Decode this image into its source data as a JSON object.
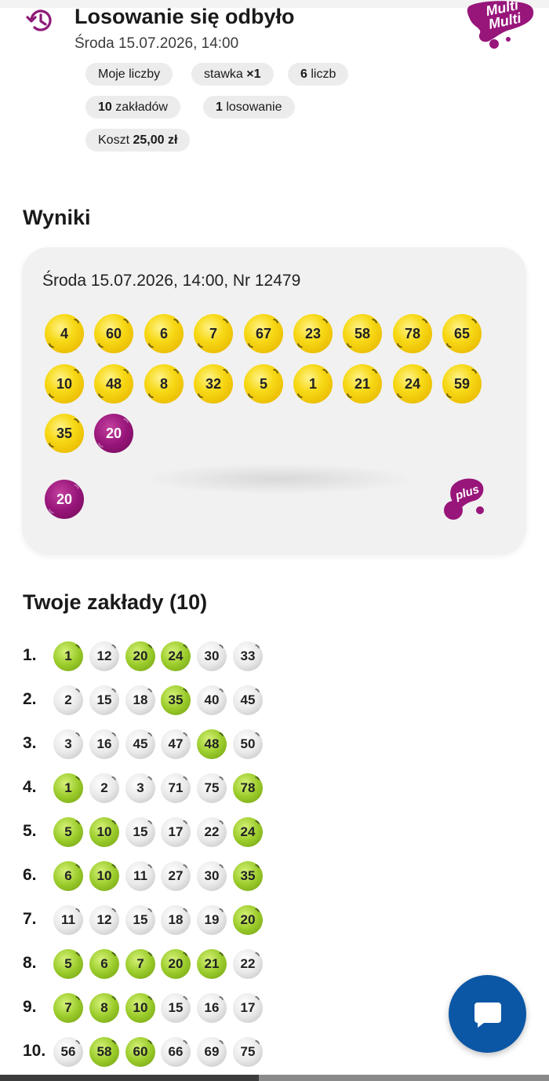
{
  "header": {
    "title": "Losowanie się odbyło",
    "subtitle": "Środa 15.07.2026, 14:00",
    "logo_text": "Multi Multi",
    "icon": "history-icon"
  },
  "chips": {
    "mine": "Moje liczby",
    "stake_prefix": "stawka ",
    "stake_value": "×1",
    "numbers_value": "6",
    "numbers_suffix": " liczb",
    "bets_value": "10",
    "bets_suffix": " zakładów",
    "draws_value": "1",
    "draws_suffix": " losowanie",
    "cost_prefix": "Koszt ",
    "cost_value": "25,00 zł"
  },
  "results": {
    "heading": "Wyniki",
    "draw_info": "Środa 15.07.2026, 14:00, Nr 12479",
    "numbers": [
      "4",
      "60",
      "6",
      "7",
      "67",
      "23",
      "58",
      "78",
      "65",
      "10",
      "48",
      "8",
      "32",
      "5",
      "1",
      "21",
      "24",
      "59",
      "35"
    ],
    "bonus": "20",
    "plus_number": "20",
    "plus_logo": "plus",
    "colors": {
      "yellow": "#f7d916",
      "purple": "#98157a",
      "green": "#9bcc2b"
    }
  },
  "bets": {
    "heading": "Twoje zakłady (10)",
    "rows": [
      {
        "label": "1.",
        "numbers": [
          "1",
          "12",
          "20",
          "24",
          "30",
          "33"
        ],
        "hits": [
          true,
          false,
          true,
          true,
          false,
          false
        ]
      },
      {
        "label": "2.",
        "numbers": [
          "2",
          "15",
          "18",
          "35",
          "40",
          "45"
        ],
        "hits": [
          false,
          false,
          false,
          true,
          false,
          false
        ]
      },
      {
        "label": "3.",
        "numbers": [
          "3",
          "16",
          "45",
          "47",
          "48",
          "50"
        ],
        "hits": [
          false,
          false,
          false,
          false,
          true,
          false
        ]
      },
      {
        "label": "4.",
        "numbers": [
          "1",
          "2",
          "3",
          "71",
          "75",
          "78"
        ],
        "hits": [
          true,
          false,
          false,
          false,
          false,
          true
        ]
      },
      {
        "label": "5.",
        "numbers": [
          "5",
          "10",
          "15",
          "17",
          "22",
          "24"
        ],
        "hits": [
          true,
          true,
          false,
          false,
          false,
          true
        ]
      },
      {
        "label": "6.",
        "numbers": [
          "6",
          "10",
          "11",
          "27",
          "30",
          "35"
        ],
        "hits": [
          true,
          true,
          false,
          false,
          false,
          true
        ]
      },
      {
        "label": "7.",
        "numbers": [
          "11",
          "12",
          "15",
          "18",
          "19",
          "20"
        ],
        "hits": [
          false,
          false,
          false,
          false,
          false,
          true
        ]
      },
      {
        "label": "8.",
        "numbers": [
          "5",
          "6",
          "7",
          "20",
          "21",
          "22"
        ],
        "hits": [
          true,
          true,
          true,
          true,
          true,
          false
        ]
      },
      {
        "label": "9.",
        "numbers": [
          "7",
          "8",
          "10",
          "15",
          "16",
          "17"
        ],
        "hits": [
          true,
          true,
          true,
          false,
          false,
          false
        ]
      },
      {
        "label": "10.",
        "numbers": [
          "56",
          "58",
          "60",
          "66",
          "69",
          "75"
        ],
        "hits": [
          false,
          true,
          true,
          false,
          false,
          false
        ]
      }
    ]
  },
  "chat": {
    "icon": "chat-bubble-icon"
  }
}
